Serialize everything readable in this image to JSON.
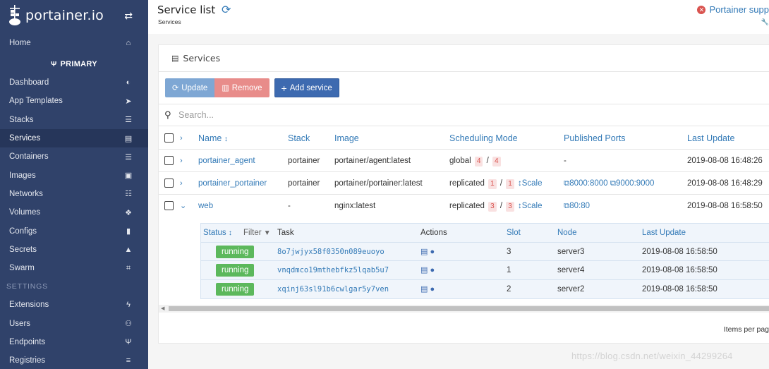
{
  "app": {
    "logo_text": "portainer.io"
  },
  "header": {
    "title": "Service list",
    "breadcrumb": "Services",
    "support_text": "Portainer supp",
    "support_icon": "times-circle-icon",
    "refresh_icon": "refresh-icon"
  },
  "sidebar": {
    "home": "Home",
    "endpoint": "PRIMARY",
    "items": [
      {
        "label": "Dashboard",
        "icon": "tachometer-icon",
        "glyph": "◐"
      },
      {
        "label": "App Templates",
        "icon": "rocket-icon",
        "glyph": "➤"
      },
      {
        "label": "Stacks",
        "icon": "th-list-icon",
        "glyph": "☰"
      },
      {
        "label": "Services",
        "icon": "list-alt-icon",
        "glyph": "▤"
      },
      {
        "label": "Containers",
        "icon": "server-icon",
        "glyph": "☰"
      },
      {
        "label": "Images",
        "icon": "clone-icon",
        "glyph": "▣"
      },
      {
        "label": "Networks",
        "icon": "sitemap-icon",
        "glyph": "☷"
      },
      {
        "label": "Volumes",
        "icon": "cubes-icon",
        "glyph": "❖"
      },
      {
        "label": "Configs",
        "icon": "file-code-icon",
        "glyph": "▮"
      },
      {
        "label": "Secrets",
        "icon": "user-secret-icon",
        "glyph": "▲"
      },
      {
        "label": "Swarm",
        "icon": "object-group-icon",
        "glyph": "⌗"
      }
    ],
    "settings_label": "SETTINGS",
    "settings_items": [
      {
        "label": "Extensions",
        "icon": "bolt-icon",
        "glyph": "ϟ"
      },
      {
        "label": "Users",
        "icon": "users-icon",
        "glyph": "⚇"
      },
      {
        "label": "Endpoints",
        "icon": "plug-icon",
        "glyph": "Ψ"
      },
      {
        "label": "Registries",
        "icon": "database-icon",
        "glyph": "≡"
      }
    ]
  },
  "panel": {
    "title": "Services",
    "buttons": {
      "update": "Update",
      "remove": "Remove",
      "add": "Add service"
    },
    "search_placeholder": "Search...",
    "columns": [
      "Name",
      "Stack",
      "Image",
      "Scheduling Mode",
      "Published Ports",
      "Last Update"
    ],
    "sort_glyph": "↕",
    "services": [
      {
        "name": "portainer_agent",
        "stack": "portainer",
        "image": "portainer/agent:latest",
        "mode": "global",
        "running": "4",
        "desired": "4",
        "scale": "",
        "ports": [
          "-"
        ],
        "last_update": "2019-08-08 16:48:26",
        "expanded": false
      },
      {
        "name": "portainer_portainer",
        "stack": "portainer",
        "image": "portainer/portainer:latest",
        "mode": "replicated",
        "running": "1",
        "desired": "1",
        "scale": "Scale",
        "ports": [
          "8000:8000",
          "9000:9000"
        ],
        "last_update": "2019-08-08 16:48:29",
        "expanded": false
      },
      {
        "name": "web",
        "stack": "-",
        "image": "nginx:latest",
        "mode": "replicated",
        "running": "3",
        "desired": "3",
        "scale": "Scale",
        "ports": [
          "80:80"
        ],
        "last_update": "2019-08-08 16:58:50",
        "expanded": true
      }
    ],
    "task_columns": {
      "status": "Status",
      "filter": "Filter",
      "task": "Task",
      "actions": "Actions",
      "slot": "Slot",
      "node": "Node",
      "last_update": "Last Update"
    },
    "tasks": [
      {
        "status": "running",
        "id": "8o7jwjyx58f0350n089euoyo",
        "slot": "3",
        "node": "server3",
        "last_update": "2019-08-08 16:58:50"
      },
      {
        "status": "running",
        "id": "vnqdmco19mthebfkz5lqab5u7",
        "slot": "1",
        "node": "server4",
        "last_update": "2019-08-08 16:58:50"
      },
      {
        "status": "running",
        "id": "xqinj63sl91b6cwlgar5y7ven",
        "slot": "2",
        "node": "server2",
        "last_update": "2019-08-08 16:58:50"
      }
    ],
    "items_per_page": "Items per pag"
  },
  "watermark": "https://blog.csdn.net/weixin_44299264",
  "colors": {
    "sidebar": "#30426a",
    "link": "#337ab7",
    "running": "#5cb85c",
    "danger": "#d9534f"
  }
}
